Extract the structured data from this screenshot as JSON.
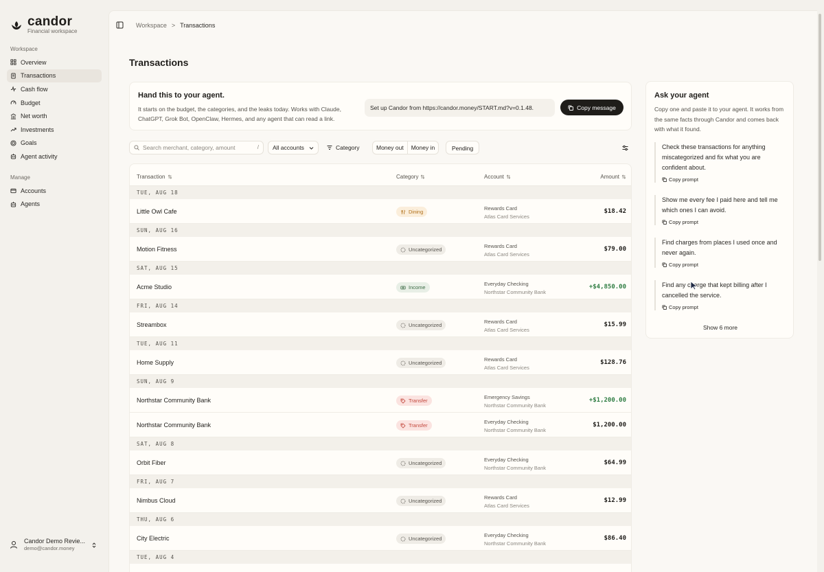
{
  "brand": {
    "name": "candor",
    "subtitle": "Financial workspace"
  },
  "sidebar": {
    "workspace_label": "Workspace",
    "manage_label": "Manage",
    "workspace_items": [
      {
        "label": "Overview",
        "icon": "grid-icon",
        "active": false
      },
      {
        "label": "Transactions",
        "icon": "receipt-icon",
        "active": true
      },
      {
        "label": "Cash flow",
        "icon": "pulse-icon",
        "active": false
      },
      {
        "label": "Budget",
        "icon": "gauge-icon",
        "active": false
      },
      {
        "label": "Net worth",
        "icon": "bank-icon",
        "active": false
      },
      {
        "label": "Investments",
        "icon": "trend-up-icon",
        "active": false
      },
      {
        "label": "Goals",
        "icon": "target-icon",
        "active": false
      },
      {
        "label": "Agent activity",
        "icon": "bot-icon",
        "active": false
      }
    ],
    "manage_items": [
      {
        "label": "Accounts",
        "icon": "wallet-icon"
      },
      {
        "label": "Agents",
        "icon": "bot-icon"
      }
    ],
    "user": {
      "name": "Candor Demo Revie...",
      "email": "demo@candor.money"
    }
  },
  "breadcrumb": {
    "root": "Workspace",
    "separator": ">",
    "current": "Transactions"
  },
  "page_title": "Transactions",
  "handoff": {
    "title": "Hand this to your agent.",
    "description": "It starts on the budget, the categories, and the leaks today. Works with Claude, ChatGPT, Grok Bot, OpenClaw, Hermes, and any agent that can read a link.",
    "setup_text": "Set up Candor from https://candor.money/START.md?v=0.1.48.",
    "copy_label": "Copy message"
  },
  "filters": {
    "search_placeholder": "Search merchant, category, amount",
    "search_shortcut": "/",
    "accounts_label": "All accounts",
    "category_label": "Category",
    "money_out": "Money out",
    "money_in": "Money in",
    "pending": "Pending"
  },
  "table": {
    "columns": {
      "transaction": "Transaction",
      "category": "Category",
      "account": "Account",
      "amount": "Amount"
    },
    "groups": [
      {
        "date": "TUE, AUG 18",
        "rows": [
          {
            "name": "Little Owl Cafe",
            "category": "Dining",
            "kind": "dining",
            "account": "Rewards Card",
            "institution": "Atlas Card Services",
            "amount": "$18.42",
            "positive": false
          }
        ]
      },
      {
        "date": "SUN, AUG 16",
        "rows": [
          {
            "name": "Motion Fitness",
            "category": "Uncategorized",
            "kind": "uncat",
            "account": "Rewards Card",
            "institution": "Atlas Card Services",
            "amount": "$79.00",
            "positive": false
          }
        ]
      },
      {
        "date": "SAT, AUG 15",
        "rows": [
          {
            "name": "Acme Studio",
            "category": "Income",
            "kind": "income",
            "account": "Everyday Checking",
            "institution": "Northstar Community Bank",
            "amount": "+$4,850.00",
            "positive": true
          }
        ]
      },
      {
        "date": "FRI, AUG 14",
        "rows": [
          {
            "name": "Streambox",
            "category": "Uncategorized",
            "kind": "uncat",
            "account": "Rewards Card",
            "institution": "Atlas Card Services",
            "amount": "$15.99",
            "positive": false
          }
        ]
      },
      {
        "date": "TUE, AUG 11",
        "rows": [
          {
            "name": "Home Supply",
            "category": "Uncategorized",
            "kind": "uncat",
            "account": "Rewards Card",
            "institution": "Atlas Card Services",
            "amount": "$128.76",
            "positive": false
          }
        ]
      },
      {
        "date": "SUN, AUG 9",
        "rows": [
          {
            "name": "Northstar Community Bank",
            "category": "Transfer",
            "kind": "transfer",
            "account": "Emergency Savings",
            "institution": "Northstar Community Bank",
            "amount": "+$1,200.00",
            "positive": true
          },
          {
            "name": "Northstar Community Bank",
            "category": "Transfer",
            "kind": "transfer",
            "account": "Everyday Checking",
            "institution": "Northstar Community Bank",
            "amount": "$1,200.00",
            "positive": false
          }
        ]
      },
      {
        "date": "SAT, AUG 8",
        "rows": [
          {
            "name": "Orbit Fiber",
            "category": "Uncategorized",
            "kind": "uncat",
            "account": "Everyday Checking",
            "institution": "Northstar Community Bank",
            "amount": "$64.99",
            "positive": false
          }
        ]
      },
      {
        "date": "FRI, AUG 7",
        "rows": [
          {
            "name": "Nimbus Cloud",
            "category": "Uncategorized",
            "kind": "uncat",
            "account": "Rewards Card",
            "institution": "Atlas Card Services",
            "amount": "$12.99",
            "positive": false
          }
        ]
      },
      {
        "date": "THU, AUG 6",
        "rows": [
          {
            "name": "City Electric",
            "category": "Uncategorized",
            "kind": "uncat",
            "account": "Everyday Checking",
            "institution": "Northstar Community Bank",
            "amount": "$86.40",
            "positive": false
          }
        ]
      },
      {
        "date": "TUE, AUG 4",
        "rows": []
      }
    ]
  },
  "agent_panel": {
    "title": "Ask your agent",
    "description": "Copy one and paste it to your agent. It works from the same facts through Candor and comes back with what it found.",
    "copy_label": "Copy prompt",
    "prompts": [
      "Check these transactions for anything miscategorized and fix what you are confident about.",
      "Show me every fee I paid here and tell me which ones I can avoid.",
      "Find charges from places I used once and never again.",
      "Find any charge that kept billing after I cancelled the service."
    ],
    "show_more": "Show 6 more"
  },
  "colors": {
    "background": "#f3f1ec",
    "surface": "#fffdf9",
    "dark_button": "#1f1d1a",
    "positive": "#2f7d43",
    "dining_bg": "#fbeedb",
    "dining_fg": "#b0701a",
    "income_bg": "#e8efe6",
    "income_fg": "#3d6b45",
    "transfer_bg": "#fbe3e0",
    "transfer_fg": "#c2473b",
    "uncat_bg": "#efece6",
    "uncat_fg": "#55524c"
  }
}
